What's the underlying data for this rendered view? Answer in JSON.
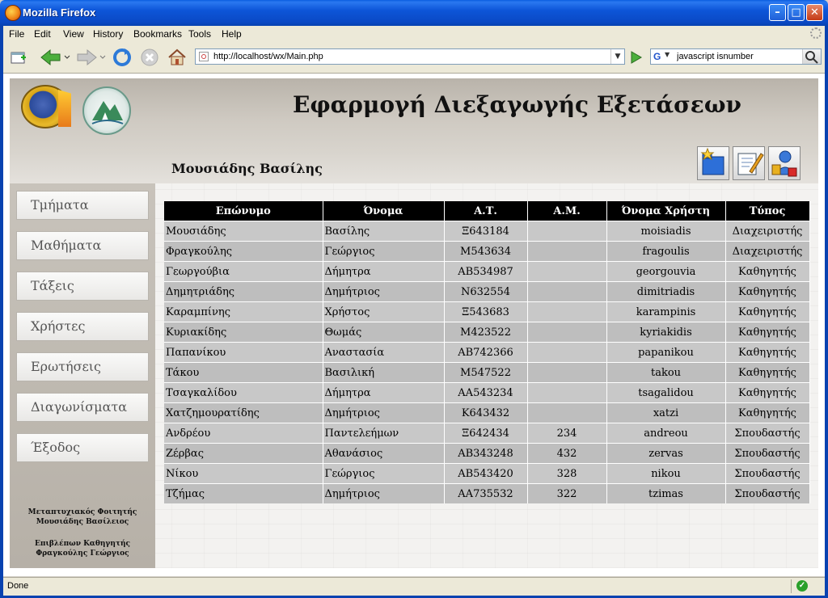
{
  "window": {
    "title": "Mozilla Firefox",
    "min_glyph": "–",
    "max_glyph": "□",
    "close_glyph": "✕"
  },
  "menubar": {
    "items": [
      "File",
      "Edit",
      "View",
      "History",
      "Bookmarks",
      "Tools",
      "Help"
    ]
  },
  "navbar": {
    "url": "http://localhost/wx/Main.php",
    "search_engine": "G",
    "search_value": "javascript isnumber",
    "dropdown_glyph": "▼"
  },
  "page": {
    "title": "Εφαρμογή Διεξαγωγής Εξετάσεων",
    "user_name": "Μουσιάδης Βασίλης",
    "nav": [
      "Τμήματα",
      "Μαθήματα",
      "Τάξεις",
      "Χρήστες",
      "Ερωτήσεις",
      "Διαγωνίσματα",
      "Έξοδος"
    ],
    "credits": {
      "role1": "Μεταπτυχιακός Φοιτητής",
      "name1": "Μουσιάδης Βασίλειος",
      "role2": "Επιβλέπων Καθηγητής",
      "name2": "Φραγκούλης Γεώργιος"
    },
    "table": {
      "headers": [
        "Επώνυμο",
        "Όνομα",
        "Α.Τ.",
        "Α.Μ.",
        "Όνομα Χρήστη",
        "Τύπος"
      ],
      "rows": [
        [
          "Μουσιάδης",
          "Βασίλης",
          "Ξ643184",
          "",
          "moisiadis",
          "Διαχειριστής"
        ],
        [
          "Φραγκούλης",
          "Γεώργιος",
          "Μ543634",
          "",
          "fragoulis",
          "Διαχειριστής"
        ],
        [
          "Γεωργούβια",
          "Δήμητρα",
          "ΑΒ534987",
          "",
          "georgouvia",
          "Καθηγητής"
        ],
        [
          "Δημητριάδης",
          "Δημήτριος",
          "Ν632554",
          "",
          "dimitriadis",
          "Καθηγητής"
        ],
        [
          "Καραμπίνης",
          "Χρήστος",
          "Ξ543683",
          "",
          "karampinis",
          "Καθηγητής"
        ],
        [
          "Κυριακίδης",
          "Θωμάς",
          "Μ423522",
          "",
          "kyriakidis",
          "Καθηγητής"
        ],
        [
          "Παπανίκου",
          "Αναστασία",
          "ΑΒ742366",
          "",
          "papanikou",
          "Καθηγητής"
        ],
        [
          "Τάκου",
          "Βασιλική",
          "Μ547522",
          "",
          "takou",
          "Καθηγητής"
        ],
        [
          "Τσαγκαλίδου",
          "Δήμητρα",
          "ΑΑ543234",
          "",
          "tsagalidou",
          "Καθηγητής"
        ],
        [
          "Χατζημουρατίδης",
          "Δημήτριος",
          "Κ643432",
          "",
          "xatzi",
          "Καθηγητής"
        ],
        [
          "Ανδρέου",
          "Παντελεήμων",
          "Ξ642434",
          "234",
          "andreou",
          "Σπουδαστής"
        ],
        [
          "Ζέρβας",
          "Αθανάσιος",
          "ΑΒ343248",
          "432",
          "zervas",
          "Σπουδαστής"
        ],
        [
          "Νίκου",
          "Γεώργιος",
          "ΑΒ543420",
          "328",
          "nikou",
          "Σπουδαστής"
        ],
        [
          "Τζήμας",
          "Δημήτριος",
          "ΑΑ735532",
          "322",
          "tzimas",
          "Σπουδαστής"
        ]
      ]
    }
  },
  "statusbar": {
    "text": "Done",
    "ok_glyph": "✓"
  }
}
